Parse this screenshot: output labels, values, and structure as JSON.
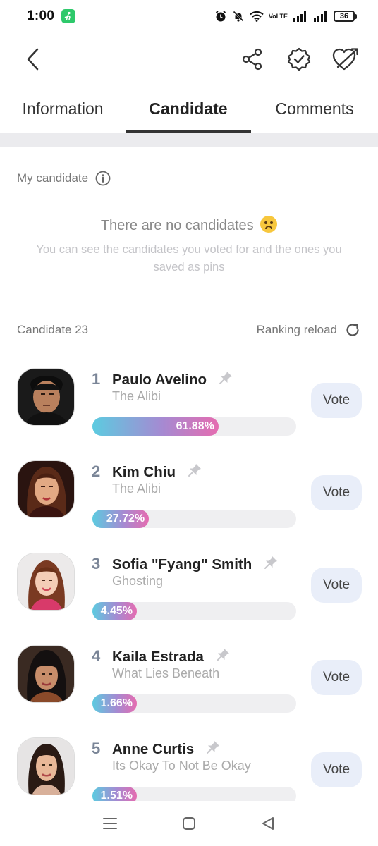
{
  "status_bar": {
    "time": "1:00",
    "network_label": "VoLTE",
    "battery": "36",
    "app_icon": "running-person-icon"
  },
  "nav": {
    "back_icon": "back-arrow-icon",
    "share_icon": "share-icon",
    "badge_icon": "verified-badge-icon",
    "favorite_icon": "heart-arrow-icon"
  },
  "tabs": [
    {
      "label": "Information",
      "active": false
    },
    {
      "label": "Candidate",
      "active": true
    },
    {
      "label": "Comments",
      "active": false
    }
  ],
  "my_candidate": {
    "label": "My candidate",
    "empty_title": "There are no candidates",
    "empty_subtitle": "You can see the candidates you voted for and the ones you saved as pins"
  },
  "candidates_header": {
    "count_label": "Candidate 23",
    "reload_label": "Ranking reload"
  },
  "candidates": [
    {
      "rank": "1",
      "name": "Paulo Avelino",
      "show": "The Alibi",
      "percent_label": "61.88%",
      "percent": 61.88,
      "vote_label": "Vote"
    },
    {
      "rank": "2",
      "name": "Kim Chiu",
      "show": "The Alibi",
      "percent_label": "27.72%",
      "percent": 27.72,
      "vote_label": "Vote"
    },
    {
      "rank": "3",
      "name": "Sofia \"Fyang\" Smith",
      "show": "Ghosting",
      "percent_label": "4.45%",
      "percent": 4.45,
      "vote_label": "Vote"
    },
    {
      "rank": "4",
      "name": "Kaila Estrada",
      "show": "What Lies Beneath",
      "percent_label": "1.66%",
      "percent": 1.66,
      "vote_label": "Vote"
    },
    {
      "rank": "5",
      "name": "Anne Curtis",
      "show": "Its Okay To Not Be Okay",
      "percent_label": "1.51%",
      "percent": 1.51,
      "vote_label": "Vote"
    }
  ],
  "colors": {
    "bar_gradient_start": "#5ccbe0",
    "bar_gradient_end": "#e56cb0",
    "vote_button_bg": "#e9eef9",
    "rank_color": "#7a8597"
  }
}
